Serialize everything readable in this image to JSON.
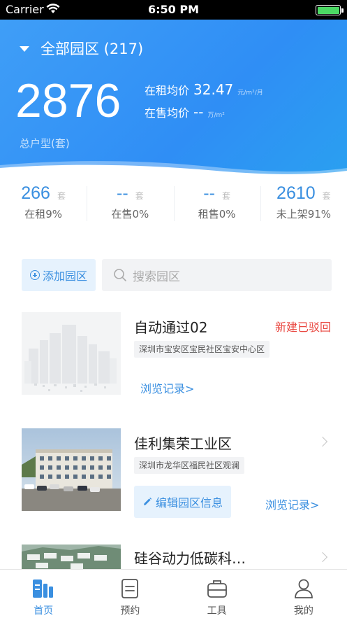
{
  "status_bar": {
    "carrier": "Carrier",
    "time": "6:50 PM"
  },
  "header": {
    "park_selector": "全部园区 (217)",
    "total_count": "2876",
    "total_label": "总户型(套)",
    "rent_price": {
      "label": "在租均价",
      "value": "32.47",
      "unit": "元/m²/月"
    },
    "sale_price": {
      "label": "在售均价",
      "value": "--",
      "unit": "万/m²"
    },
    "accent_color": "#3a8fe0"
  },
  "stats": [
    {
      "value": "266",
      "unit": "套",
      "label": "在租9%"
    },
    {
      "value": "--",
      "unit": "套",
      "label": "在售0%"
    },
    {
      "value": "--",
      "unit": "套",
      "label": "租售0%"
    },
    {
      "value": "2610",
      "unit": "套",
      "label": "未上架91%"
    }
  ],
  "actions": {
    "add_park": "添加园区",
    "search_placeholder": "搜索园区"
  },
  "parks": [
    {
      "name": "自动通过02",
      "status": "新建已驳回",
      "address": "深圳市宝安区宝民社区宝安中心区",
      "browse": "浏览记录>"
    },
    {
      "name": "佳利集荣工业区",
      "address": "深圳市龙华区福民社区观澜",
      "edit": "编辑园区信息",
      "browse": "浏览记录>"
    },
    {
      "name": "硅谷动力低碳科…"
    }
  ],
  "tabs": [
    {
      "label": "首页",
      "icon": "home-icon"
    },
    {
      "label": "预约",
      "icon": "calendar-icon"
    },
    {
      "label": "工具",
      "icon": "briefcase-icon"
    },
    {
      "label": "我的",
      "icon": "user-icon"
    }
  ]
}
